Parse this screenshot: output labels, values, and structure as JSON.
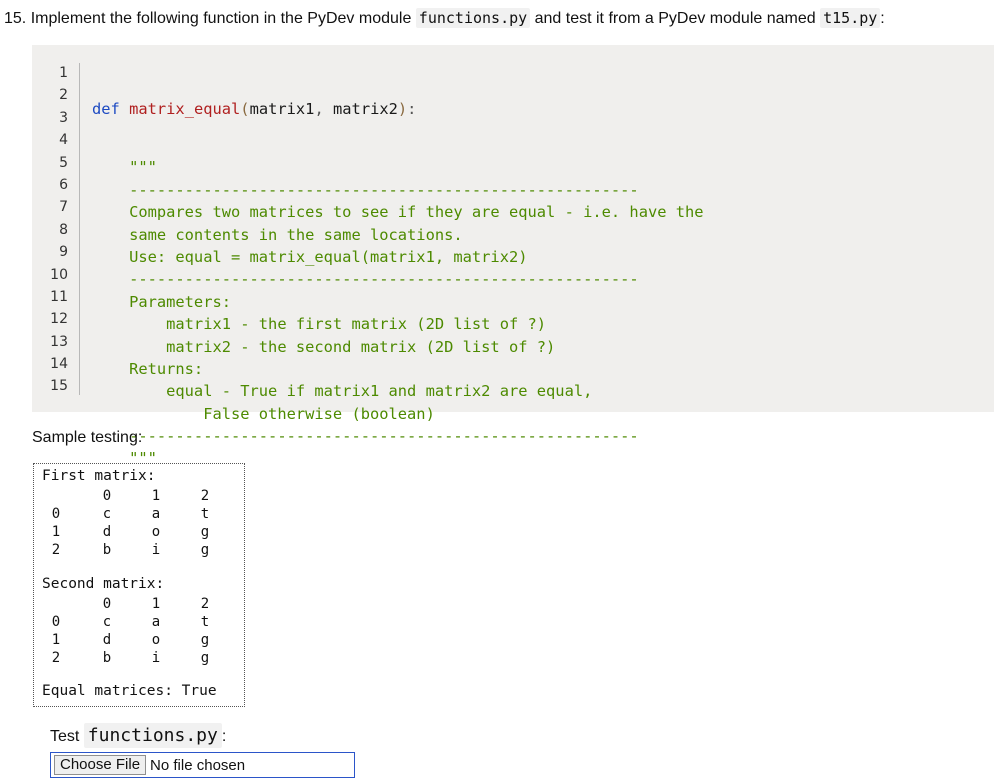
{
  "question": {
    "number_text": "15. Implement the following function in the PyDev module",
    "module_file": "functions.py",
    "middle_text": "and test it from a PyDev module named",
    "test_file": "t15.py",
    "end_text": ":"
  },
  "code": {
    "line_numbers": [
      "1",
      "2",
      "3",
      "4",
      "5",
      "6",
      "7",
      "8",
      "9",
      "10",
      "11",
      "12",
      "13",
      "14",
      "15"
    ],
    "def_kw": "def",
    "func_name": "matrix_equal",
    "open_paren": "(",
    "param1": "matrix1",
    "comma": ",",
    "param2": "matrix2",
    "close_paren": ")",
    "colon": ":",
    "doc_lines": [
      "    \"\"\"",
      "    -------------------------------------------------------",
      "    Compares two matrices to see if they are equal - i.e. have the",
      "    same contents in the same locations.",
      "    Use: equal = matrix_equal(matrix1, matrix2)",
      "    -------------------------------------------------------",
      "    Parameters:",
      "        matrix1 - the first matrix (2D list of ?)",
      "        matrix2 - the second matrix (2D list of ?)",
      "    Returns:",
      "        equal - True if matrix1 and matrix2 are equal,",
      "            False otherwise (boolean)",
      "    -------------------------------------------------------",
      "    \"\"\""
    ]
  },
  "sample": {
    "label": "Sample testing:",
    "first_title": "First matrix:",
    "second_title": "Second matrix:",
    "col_headers": [
      "0",
      "1",
      "2"
    ],
    "row_headers": [
      "0",
      "1",
      "2"
    ],
    "first_rows": [
      [
        "c",
        "a",
        "t"
      ],
      [
        "d",
        "o",
        "g"
      ],
      [
        "b",
        "i",
        "g"
      ]
    ],
    "second_rows": [
      [
        "c",
        "a",
        "t"
      ],
      [
        "d",
        "o",
        "g"
      ],
      [
        "b",
        "i",
        "g"
      ]
    ],
    "result": "Equal matrices: True"
  },
  "test": {
    "label": "Test",
    "file": "functions.py",
    "colon": ":",
    "choose_button": "Choose File",
    "no_file": "No file chosen"
  }
}
